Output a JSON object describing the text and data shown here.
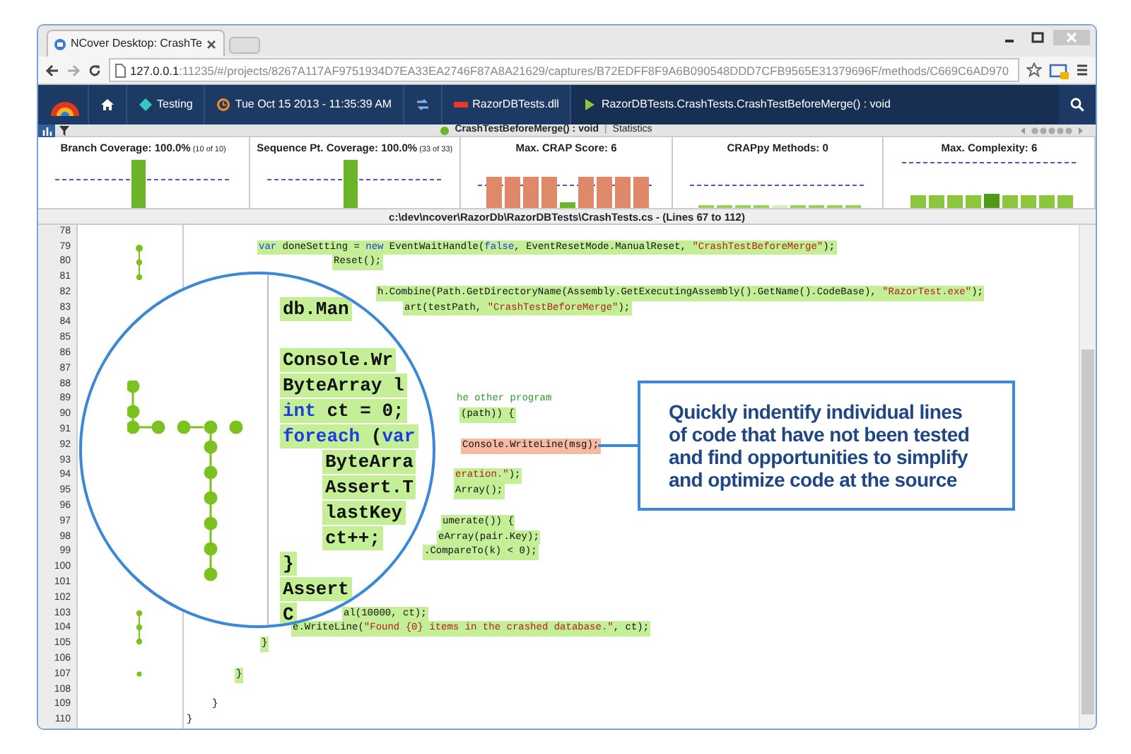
{
  "browser": {
    "tab_title": "NCover Desktop: CrashTe",
    "url_host": "127.0.0.1",
    "url_path": ":11235/#/projects/8267A117AF9751934D7EA33EA2746F87A8A21629/captures/B72EDFF8F9A6B090548DDD7CFB9565E31379696F/methods/C669C6AD970"
  },
  "breadcrumbs": [
    {
      "kind": "home"
    },
    {
      "kind": "project",
      "label": "Testing"
    },
    {
      "kind": "capture",
      "label": "Tue Oct 15 2013 - 11:35:39 AM"
    },
    {
      "kind": "compare"
    },
    {
      "kind": "module",
      "label": "RazorDBTests.dll"
    },
    {
      "kind": "method",
      "label": "RazorDBTests.CrashTests.CrashTestBeforeMerge() : void"
    }
  ],
  "toolbar": {
    "title": "CrashTestBeforeMerge() : void",
    "separator": "|",
    "link": "Statistics"
  },
  "metrics": [
    {
      "label": "Branch Coverage: 100.0%",
      "detail": "(10 of 10)",
      "kind": "single"
    },
    {
      "label": "Sequence Pt. Coverage: 100.0%",
      "detail": "(33 of 33)",
      "kind": "single"
    },
    {
      "label": "Max. CRAP Score: 6",
      "kind": "crap"
    },
    {
      "label": "CRAPpy Methods: 0",
      "kind": "crappy"
    },
    {
      "label": "Max. Complexity: 6",
      "kind": "complexity"
    }
  ],
  "file": {
    "path": "c:\\dev\\ncover\\RazorDb\\RazorDBTests\\CrashTests.cs",
    "range": " - (Lines 67 to 112)"
  },
  "code_lines": [
    {
      "number": "78"
    },
    {
      "number": "79",
      "kind": "covered",
      "segments": [
        {
          "kind": "keyword",
          "text": "var"
        },
        {
          "kind": "plain",
          "text": " doneSetting = "
        },
        {
          "kind": "keyword",
          "text": "new"
        },
        {
          "kind": "plain",
          "text": " EventWaitHandle("
        },
        {
          "kind": "keyword",
          "text": "false"
        },
        {
          "kind": "plain",
          "text": ", EventResetMode.ManualReset, "
        },
        {
          "kind": "string",
          "text": "\"CrashTestBeforeMerge\""
        },
        {
          "kind": "plain",
          "text": ");"
        }
      ]
    },
    {
      "number": "80",
      "kind": "covered",
      "segments": [
        {
          "kind": "plain",
          "text": "Reset();"
        }
      ]
    },
    {
      "number": "81"
    },
    {
      "number": "82",
      "kind": "covered",
      "segments": [
        {
          "kind": "plain",
          "text": "h.Combine(Path.GetDirectoryName(Assembly.GetExecutingAssembly().GetName().CodeBase), "
        },
        {
          "kind": "string",
          "text": "\"RazorTest.exe\""
        },
        {
          "kind": "plain",
          "text": ");"
        }
      ]
    },
    {
      "number": "83",
      "kind": "covered",
      "segments": [
        {
          "kind": "plain",
          "text": "art(testPath, "
        },
        {
          "kind": "string",
          "text": "\"CrashTestBeforeMerge\""
        },
        {
          "kind": "plain",
          "text": ");"
        }
      ]
    },
    {
      "number": "84"
    },
    {
      "number": "85"
    },
    {
      "number": "86"
    },
    {
      "number": "87"
    },
    {
      "number": "88"
    },
    {
      "number": "89",
      "kind": "plain",
      "segments": [
        {
          "kind": "comment",
          "text": "he other program"
        }
      ]
    },
    {
      "number": "90",
      "kind": "covered",
      "segments": [
        {
          "kind": "plain",
          "text": "(path)) {"
        }
      ]
    },
    {
      "number": "91"
    },
    {
      "number": "92",
      "kind": "uncovered",
      "segments": [
        {
          "kind": "plain",
          "text": "Console.WriteLine(msg);"
        }
      ]
    },
    {
      "number": "93"
    },
    {
      "number": "94",
      "kind": "covered",
      "segments": [
        {
          "kind": "string",
          "text": "eration.\""
        },
        {
          "kind": "plain",
          "text": ");"
        }
      ]
    },
    {
      "number": "95",
      "kind": "covered",
      "segments": [
        {
          "kind": "plain",
          "text": "Array();"
        }
      ]
    },
    {
      "number": "96"
    },
    {
      "number": "97",
      "kind": "covered",
      "segments": [
        {
          "kind": "plain",
          "text": "umerate()) {"
        }
      ]
    },
    {
      "number": "98",
      "kind": "covered",
      "segments": [
        {
          "kind": "plain",
          "text": "eArray(pair.Key);"
        }
      ]
    },
    {
      "number": "99",
      "kind": "covered",
      "segments": [
        {
          "kind": "plain",
          "text": ".CompareTo(k) < 0);"
        }
      ]
    },
    {
      "number": "100"
    },
    {
      "number": "101"
    },
    {
      "number": "102"
    },
    {
      "number": "103",
      "kind": "covered",
      "segments": [
        {
          "kind": "plain",
          "text": "al(10000, ct);"
        }
      ]
    },
    {
      "number": "104",
      "kind": "covered",
      "segments": [
        {
          "kind": "plain",
          "text": "e.WriteLine("
        },
        {
          "kind": "string",
          "text": "\"Found {0} items in the crashed database.\""
        },
        {
          "kind": "plain",
          "text": ", ct);"
        }
      ]
    },
    {
      "number": "105",
      "kind": "covered",
      "segments": [
        {
          "kind": "plain",
          "text": "}"
        }
      ]
    },
    {
      "number": "106"
    },
    {
      "number": "107",
      "kind": "covered",
      "segments": [
        {
          "kind": "plain",
          "text": "}"
        }
      ]
    },
    {
      "number": "108"
    },
    {
      "number": "109",
      "kind": "plain",
      "segments": [
        {
          "kind": "plain",
          "text": "}"
        }
      ]
    },
    {
      "number": "110",
      "kind": "plain",
      "segments": [
        {
          "kind": "plain",
          "text": "}"
        }
      ]
    }
  ],
  "magnifier_lines": [
    {
      "segments": [
        {
          "kind": "plain",
          "text": "db.Man"
        }
      ]
    },
    {
      "segments": [
        {
          "kind": "plain",
          "text": "Console.Wr"
        }
      ]
    },
    {
      "segments": [
        {
          "kind": "plain",
          "text": "ByteArray l"
        }
      ]
    },
    {
      "segments": [
        {
          "kind": "keyword",
          "text": "int"
        },
        {
          "kind": "plain",
          "text": " ct = 0;"
        }
      ]
    },
    {
      "segments": [
        {
          "kind": "keyword",
          "text": "foreach"
        },
        {
          "kind": "plain",
          "text": " ("
        },
        {
          "kind": "keyword",
          "text": "var"
        }
      ]
    },
    {
      "segments": [
        {
          "kind": "plain",
          "text": "ByteArra"
        }
      ]
    },
    {
      "segments": [
        {
          "kind": "plain",
          "text": "Assert.T"
        }
      ]
    },
    {
      "segments": [
        {
          "kind": "plain",
          "text": "lastKey"
        }
      ]
    },
    {
      "segments": [
        {
          "kind": "plain",
          "text": "ct++;"
        }
      ]
    },
    {
      "segments": [
        {
          "kind": "plain",
          "text": "}"
        }
      ]
    },
    {
      "segments": [
        {
          "kind": "plain",
          "text": "Assert"
        }
      ]
    },
    {
      "segments": [
        {
          "kind": "plain",
          "text": "C"
        }
      ]
    }
  ],
  "callout": {
    "text": "Quickly indentify individual lines of code that have not been tested and find opportunities to simplify and optimize code at the source"
  }
}
